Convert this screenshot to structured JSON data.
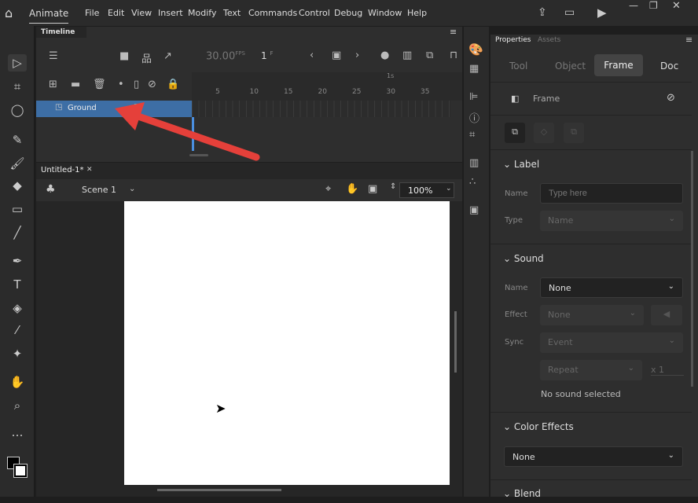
{
  "app": {
    "name": "Animate",
    "menu": [
      "File",
      "Edit",
      "View",
      "Insert",
      "Modify",
      "Text",
      "Commands",
      "Control",
      "Debug",
      "Window",
      "Help"
    ]
  },
  "timeline": {
    "title": "Timeline",
    "fps": "30.00",
    "fps_unit": "FPS",
    "frame": "1",
    "frame_unit": "F",
    "ruler_labels": [
      "5",
      "10",
      "15",
      "20",
      "25",
      "30",
      "35"
    ],
    "seconds_label": "1s",
    "layers": [
      {
        "name": "Ground",
        "selected": true
      }
    ]
  },
  "document": {
    "tab": "Untitled-1*",
    "scene": "Scene 1",
    "zoom": "100%"
  },
  "properties": {
    "tabs": [
      "Properties",
      "Assets"
    ],
    "subtabs": [
      "Tool",
      "Object",
      "Frame",
      "Doc"
    ],
    "active_subtab": "Frame",
    "header": "Frame",
    "label": {
      "title": "Label",
      "name_label": "Name",
      "name_placeholder": "Type here",
      "type_label": "Type",
      "type_value": "Name"
    },
    "sound": {
      "title": "Sound",
      "name_label": "Name",
      "name_value": "None",
      "effect_label": "Effect",
      "effect_value": "None",
      "sync_label": "Sync",
      "sync_value": "Event",
      "repeat_value": "Repeat",
      "repeat_count": "x 1",
      "status": "No sound selected"
    },
    "color_effects": {
      "title": "Color Effects",
      "value": "None"
    },
    "blend": {
      "title": "Blend"
    }
  },
  "colors": {
    "accent": "#3d6ea5",
    "playhead": "#4a8fe0",
    "arrow": "#e5403a"
  }
}
